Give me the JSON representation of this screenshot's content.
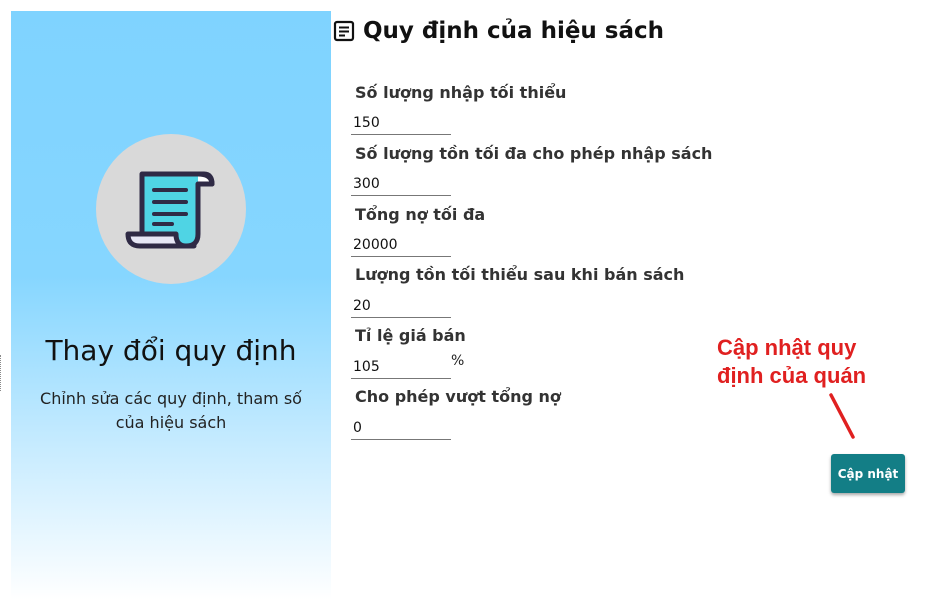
{
  "sidebar": {
    "title": "Thay đổi quy định",
    "subtitle_line1": "Chỉnh sửa các quy định, tham số",
    "subtitle_line2": "của hiệu sách",
    "icon": "scroll-icon"
  },
  "header": {
    "title": "Quy định của hiệu sách",
    "icon": "document-icon"
  },
  "form": {
    "fields": [
      {
        "label": "Số lượng nhập tối thiểu",
        "value": "150"
      },
      {
        "label": "Số lượng tồn tối đa cho phép nhập sách",
        "value": "300"
      },
      {
        "label": "Tổng nợ tối đa",
        "value": "20000"
      },
      {
        "label": "Lượng tồn tối thiểu sau khi bán sách",
        "value": "20"
      },
      {
        "label": "Tỉ lệ giá bán",
        "value": "105",
        "suffix": "%"
      },
      {
        "label": "Cho phép vượt tổng nợ",
        "value": "0"
      }
    ],
    "submit_label": "Cập nhật"
  },
  "annotation": {
    "line1": "Cập nhật quy",
    "line2": "định của quán",
    "color": "#e02020"
  },
  "colors": {
    "button": "#137e86",
    "panel_top": "#7fd3ff"
  }
}
